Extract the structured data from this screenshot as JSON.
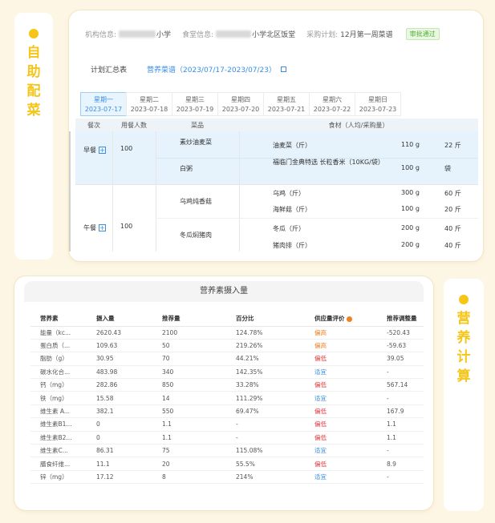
{
  "left_tab": {
    "label": "自助配菜"
  },
  "right_tab": {
    "label": "营养计算"
  },
  "top_card": {
    "org_label": "机构信息:",
    "org_value_suffix": "小学",
    "canteen_label": "食堂信息:",
    "canteen_value_suffix": "小学北区饭堂",
    "plan_label": "采购计划:",
    "plan_value": "12月第一周菜谱",
    "status_badge": "审批通过",
    "summary_label": "计划汇总表",
    "summary_link": "营养菜谱（2023/07/17-2023/07/23）",
    "days": [
      {
        "weekday": "星期一",
        "date": "2023-07-17",
        "active": true
      },
      {
        "weekday": "星期二",
        "date": "2023-07-18",
        "active": false
      },
      {
        "weekday": "星期三",
        "date": "2023-07-19",
        "active": false
      },
      {
        "weekday": "星期四",
        "date": "2023-07-20",
        "active": false
      },
      {
        "weekday": "星期五",
        "date": "2023-07-21",
        "active": false
      },
      {
        "weekday": "星期六",
        "date": "2023-07-22",
        "active": false
      },
      {
        "weekday": "星期日",
        "date": "2023-07-23",
        "active": false
      }
    ],
    "menu_headers": {
      "meal": "餐次",
      "people": "用餐人数",
      "dish": "菜品",
      "ingredients": "食材（人均/采购量）"
    },
    "meals": [
      {
        "name": "早餐",
        "people": "100",
        "dishes": [
          {
            "name": "素炒油麦菜",
            "ingredients": [
              {
                "name": "油麦菜（斤）",
                "per": "110 g",
                "qty": "22 斤"
              }
            ]
          },
          {
            "name": "白粥",
            "ingredients": [
              {
                "name": "福临门金典特选 长粒香米（10KG/袋）",
                "per": "100 g",
                "qty": "袋"
              }
            ]
          }
        ]
      },
      {
        "name": "午餐",
        "people": "100",
        "dishes": [
          {
            "name": "乌鸡炖香菇",
            "ingredients": [
              {
                "name": "乌鸡（斤）",
                "per": "300 g",
                "qty": "60 斤"
              },
              {
                "name": "海鲜菇（斤）",
                "per": "100 g",
                "qty": "20 斤"
              }
            ]
          },
          {
            "name": "冬瓜焖猪肉",
            "ingredients": [
              {
                "name": "冬瓜（斤）",
                "per": "200 g",
                "qty": "40 斤"
              },
              {
                "name": "猪肉排（斤）",
                "per": "200 g",
                "qty": "40 斤"
              }
            ]
          }
        ]
      }
    ]
  },
  "nutrition": {
    "title": "营养素摄入量",
    "headers": [
      "营养素",
      "摄入量",
      "推荐量",
      "百分比",
      "供应量评价",
      "推荐调整量"
    ],
    "rows": [
      [
        "能量（kc...",
        "2620.43",
        "2100",
        "124.78%",
        "偏高",
        "-520.43"
      ],
      [
        "蛋白质（...",
        "109.63",
        "50",
        "219.26%",
        "偏高",
        "-59.63"
      ],
      [
        "脂肪（g）",
        "30.95",
        "70",
        "44.21%",
        "偏低",
        "39.05"
      ],
      [
        "碳水化合...",
        "483.98",
        "340",
        "142.35%",
        "适宜",
        "-"
      ],
      [
        "钙（mg）",
        "282.86",
        "850",
        "33.28%",
        "偏低",
        "567.14"
      ],
      [
        "铁（mg）",
        "15.58",
        "14",
        "111.29%",
        "适宜",
        "-"
      ],
      [
        "维生素 A...",
        "382.1",
        "550",
        "69.47%",
        "偏低",
        "167.9"
      ],
      [
        "维生素B1...",
        "0",
        "1.1",
        "-",
        "偏低",
        "1.1"
      ],
      [
        "维生素B2...",
        "0",
        "1.1",
        "-",
        "偏低",
        "1.1"
      ],
      [
        "维生素C...",
        "86.31",
        "75",
        "115.08%",
        "适宜",
        "-"
      ],
      [
        "膳食纤维...",
        "11.1",
        "20",
        "55.5%",
        "偏低",
        "8.9"
      ],
      [
        "锌（mg）",
        "17.12",
        "8",
        "214%",
        "适宜",
        "-"
      ]
    ],
    "status_colors": {
      "偏高": "#f08020",
      "偏低": "#e4393c",
      "适宜": "#3a8ee6"
    }
  }
}
